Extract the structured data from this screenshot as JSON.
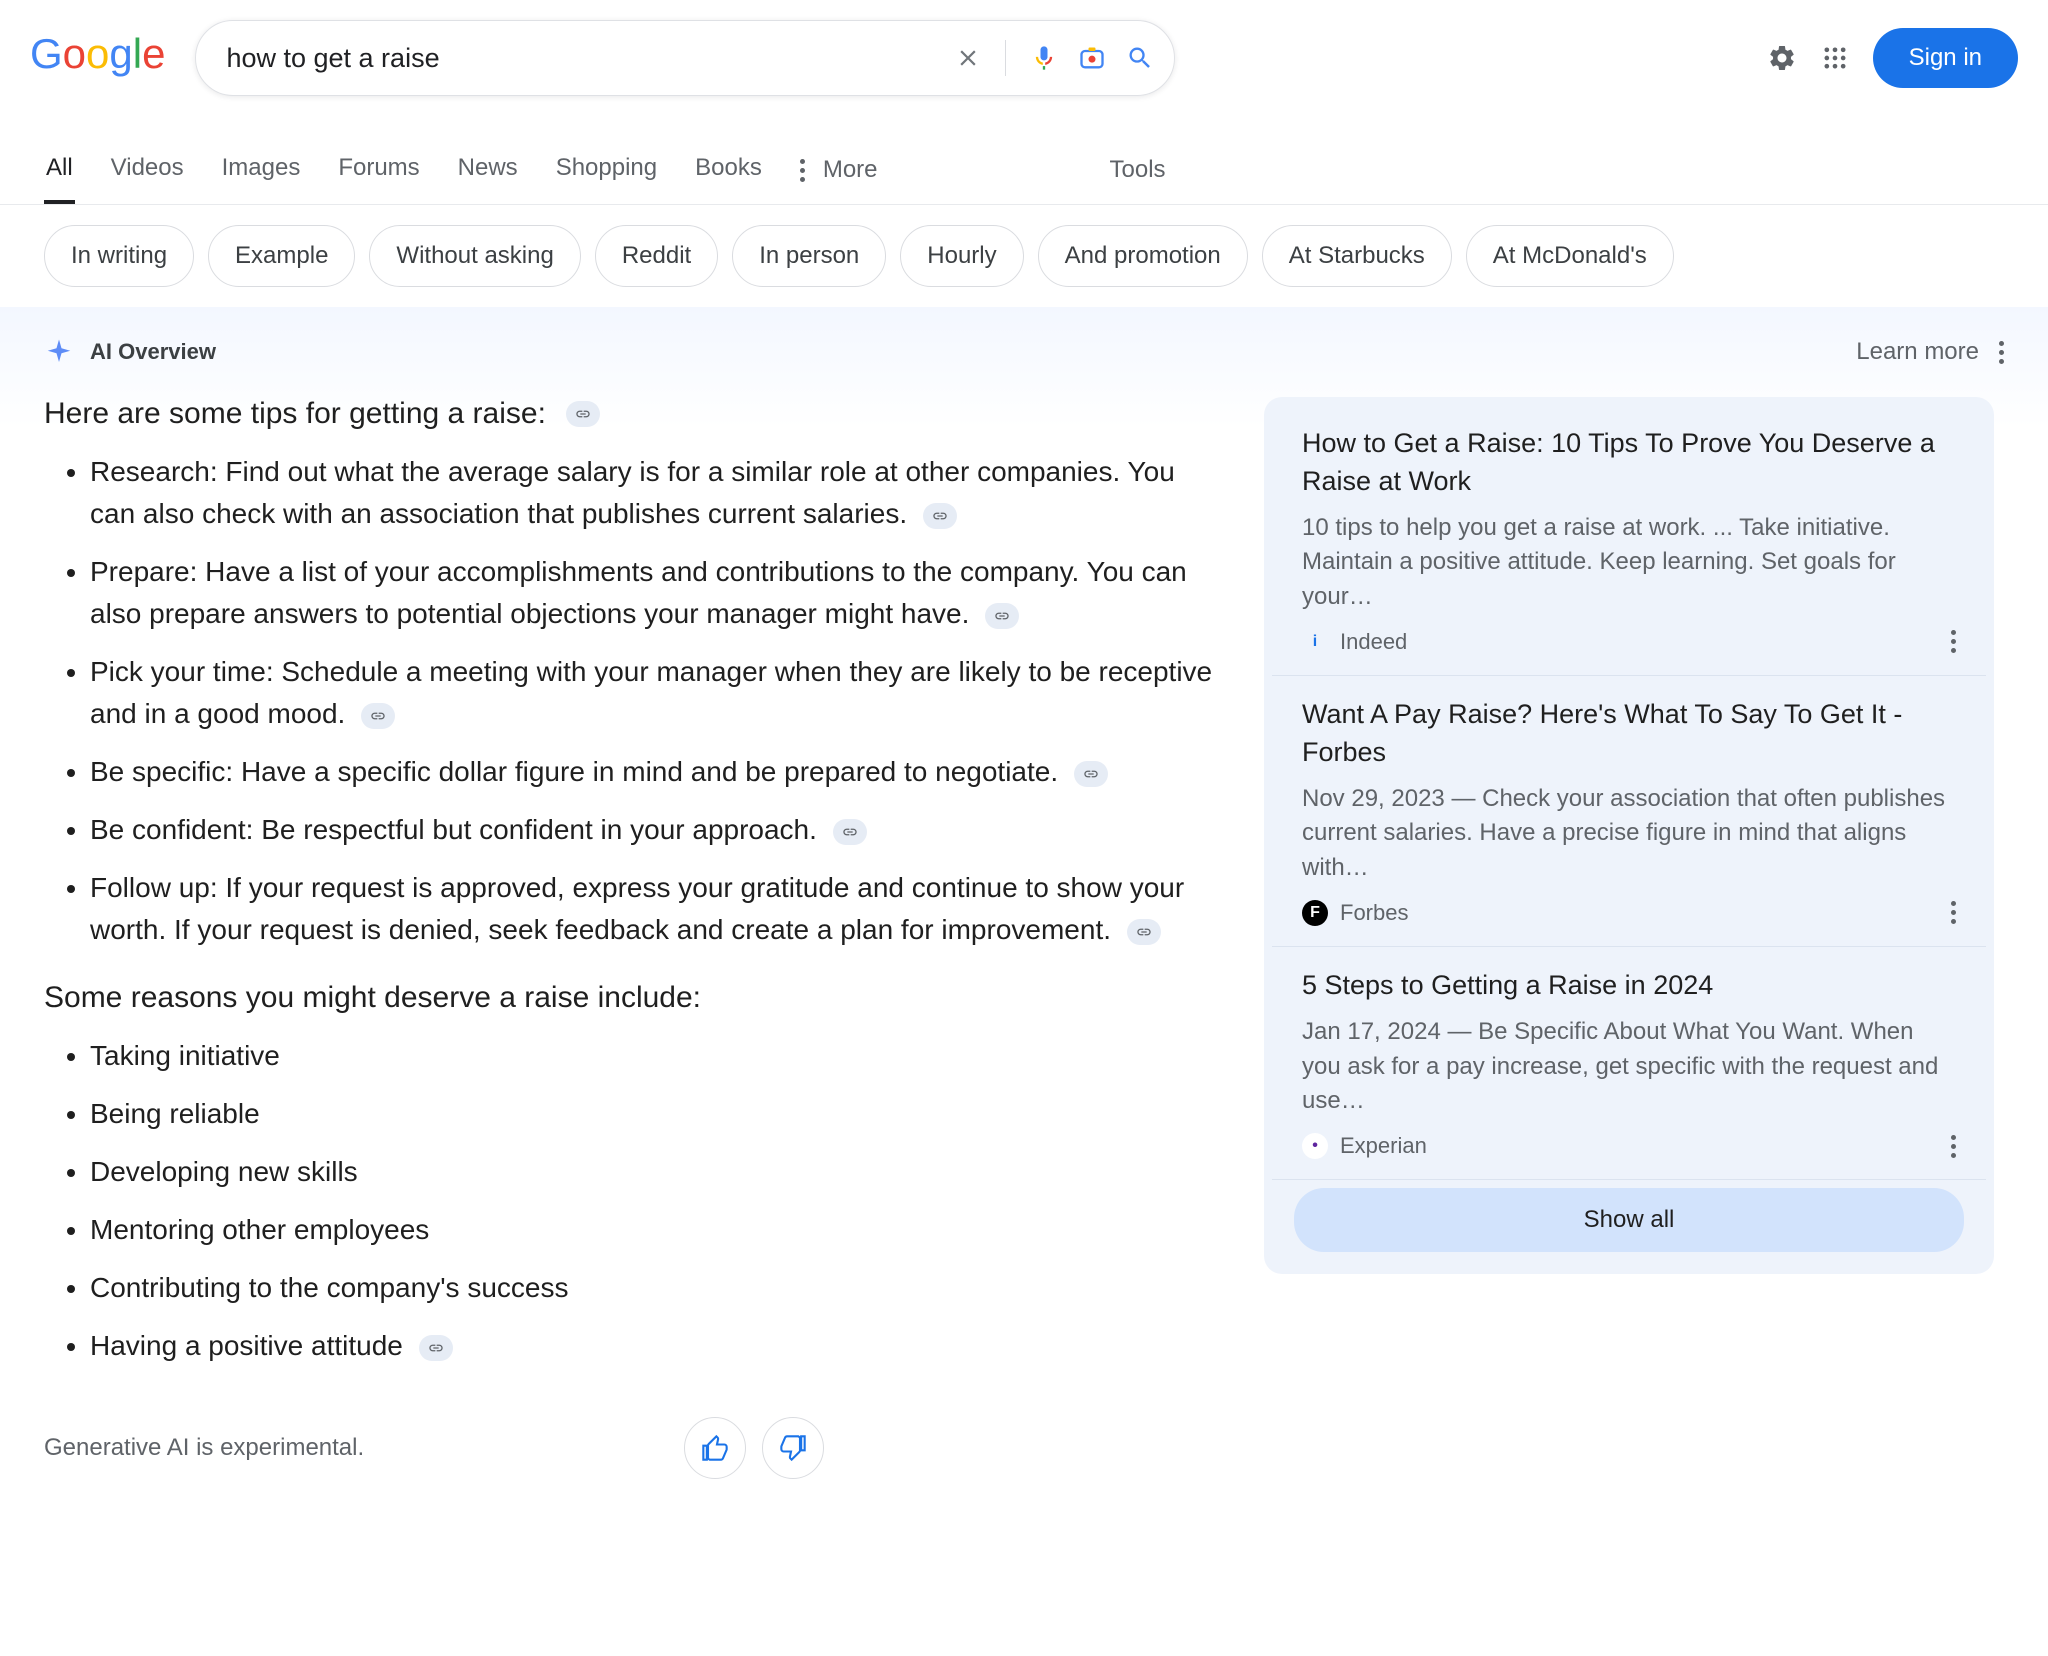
{
  "logo": [
    "G",
    "o",
    "o",
    "g",
    "l",
    "e"
  ],
  "search": {
    "query": "how to get a raise"
  },
  "header": {
    "signin": "Sign in"
  },
  "tabs": {
    "items": [
      "All",
      "Videos",
      "Images",
      "Forums",
      "News",
      "Shopping",
      "Books"
    ],
    "more": "More",
    "tools": "Tools",
    "activeIndex": 0
  },
  "chips": [
    "In writing",
    "Example",
    "Without asking",
    "Reddit",
    "In person",
    "Hourly",
    "And promotion",
    "At Starbucks",
    "At McDonald's"
  ],
  "ai": {
    "title": "AI Overview",
    "learn_more": "Learn more",
    "intro": "Here are some tips for getting a raise:",
    "tips": [
      "Research: Find out what the average salary is for a similar role at other companies. You can also check with an association that publishes current salaries.",
      "Prepare: Have a list of your accomplishments and contributions to the company. You can also prepare answers to potential objections your manager might have.",
      "Pick your time: Schedule a meeting with your manager when they are likely to be receptive and in a good mood.",
      "Be specific: Have a specific dollar figure in mind and be prepared to negotiate.",
      "Be confident: Be respectful but confident in your approach.",
      "Follow up: If your request is approved, express your gratitude and continue to show your worth. If your request is denied, seek feedback and create a plan for improvement."
    ],
    "intro2": "Some reasons you might deserve a raise include:",
    "reasons": [
      "Taking initiative",
      "Being reliable",
      "Developing new skills",
      "Mentoring other employees",
      "Contributing to the company's success",
      "Having a positive attitude"
    ],
    "experimental": "Generative AI is experimental.",
    "cards": [
      {
        "title": "How to Get a Raise: 10 Tips To Prove You Deserve a Raise at Work",
        "snippet": "10 tips to help you get a raise at work. ... Take initiative. Maintain a positive attitude. Keep learning. Set goals for your…",
        "source": "Indeed",
        "favicon_bg": "#eef3fb",
        "favicon_color": "#1a73e8",
        "favicon_text": "i"
      },
      {
        "title": "Want A Pay Raise? Here's What To Say To Get It - Forbes",
        "snippet": "Nov 29, 2023 — Check your association that often publishes current salaries. Have a precise figure in mind that aligns with…",
        "source": "Forbes",
        "favicon_bg": "#000",
        "favicon_color": "#fff",
        "favicon_text": "F"
      },
      {
        "title": "5 Steps to Getting a Raise in 2024",
        "snippet": "Jan 17, 2024 — Be Specific About What You Want. When you ask for a pay increase, get specific with the request and use…",
        "source": "Experian",
        "favicon_bg": "#fff",
        "favicon_color": "#5f259f",
        "favicon_text": "•"
      }
    ],
    "show_all": "Show all"
  }
}
